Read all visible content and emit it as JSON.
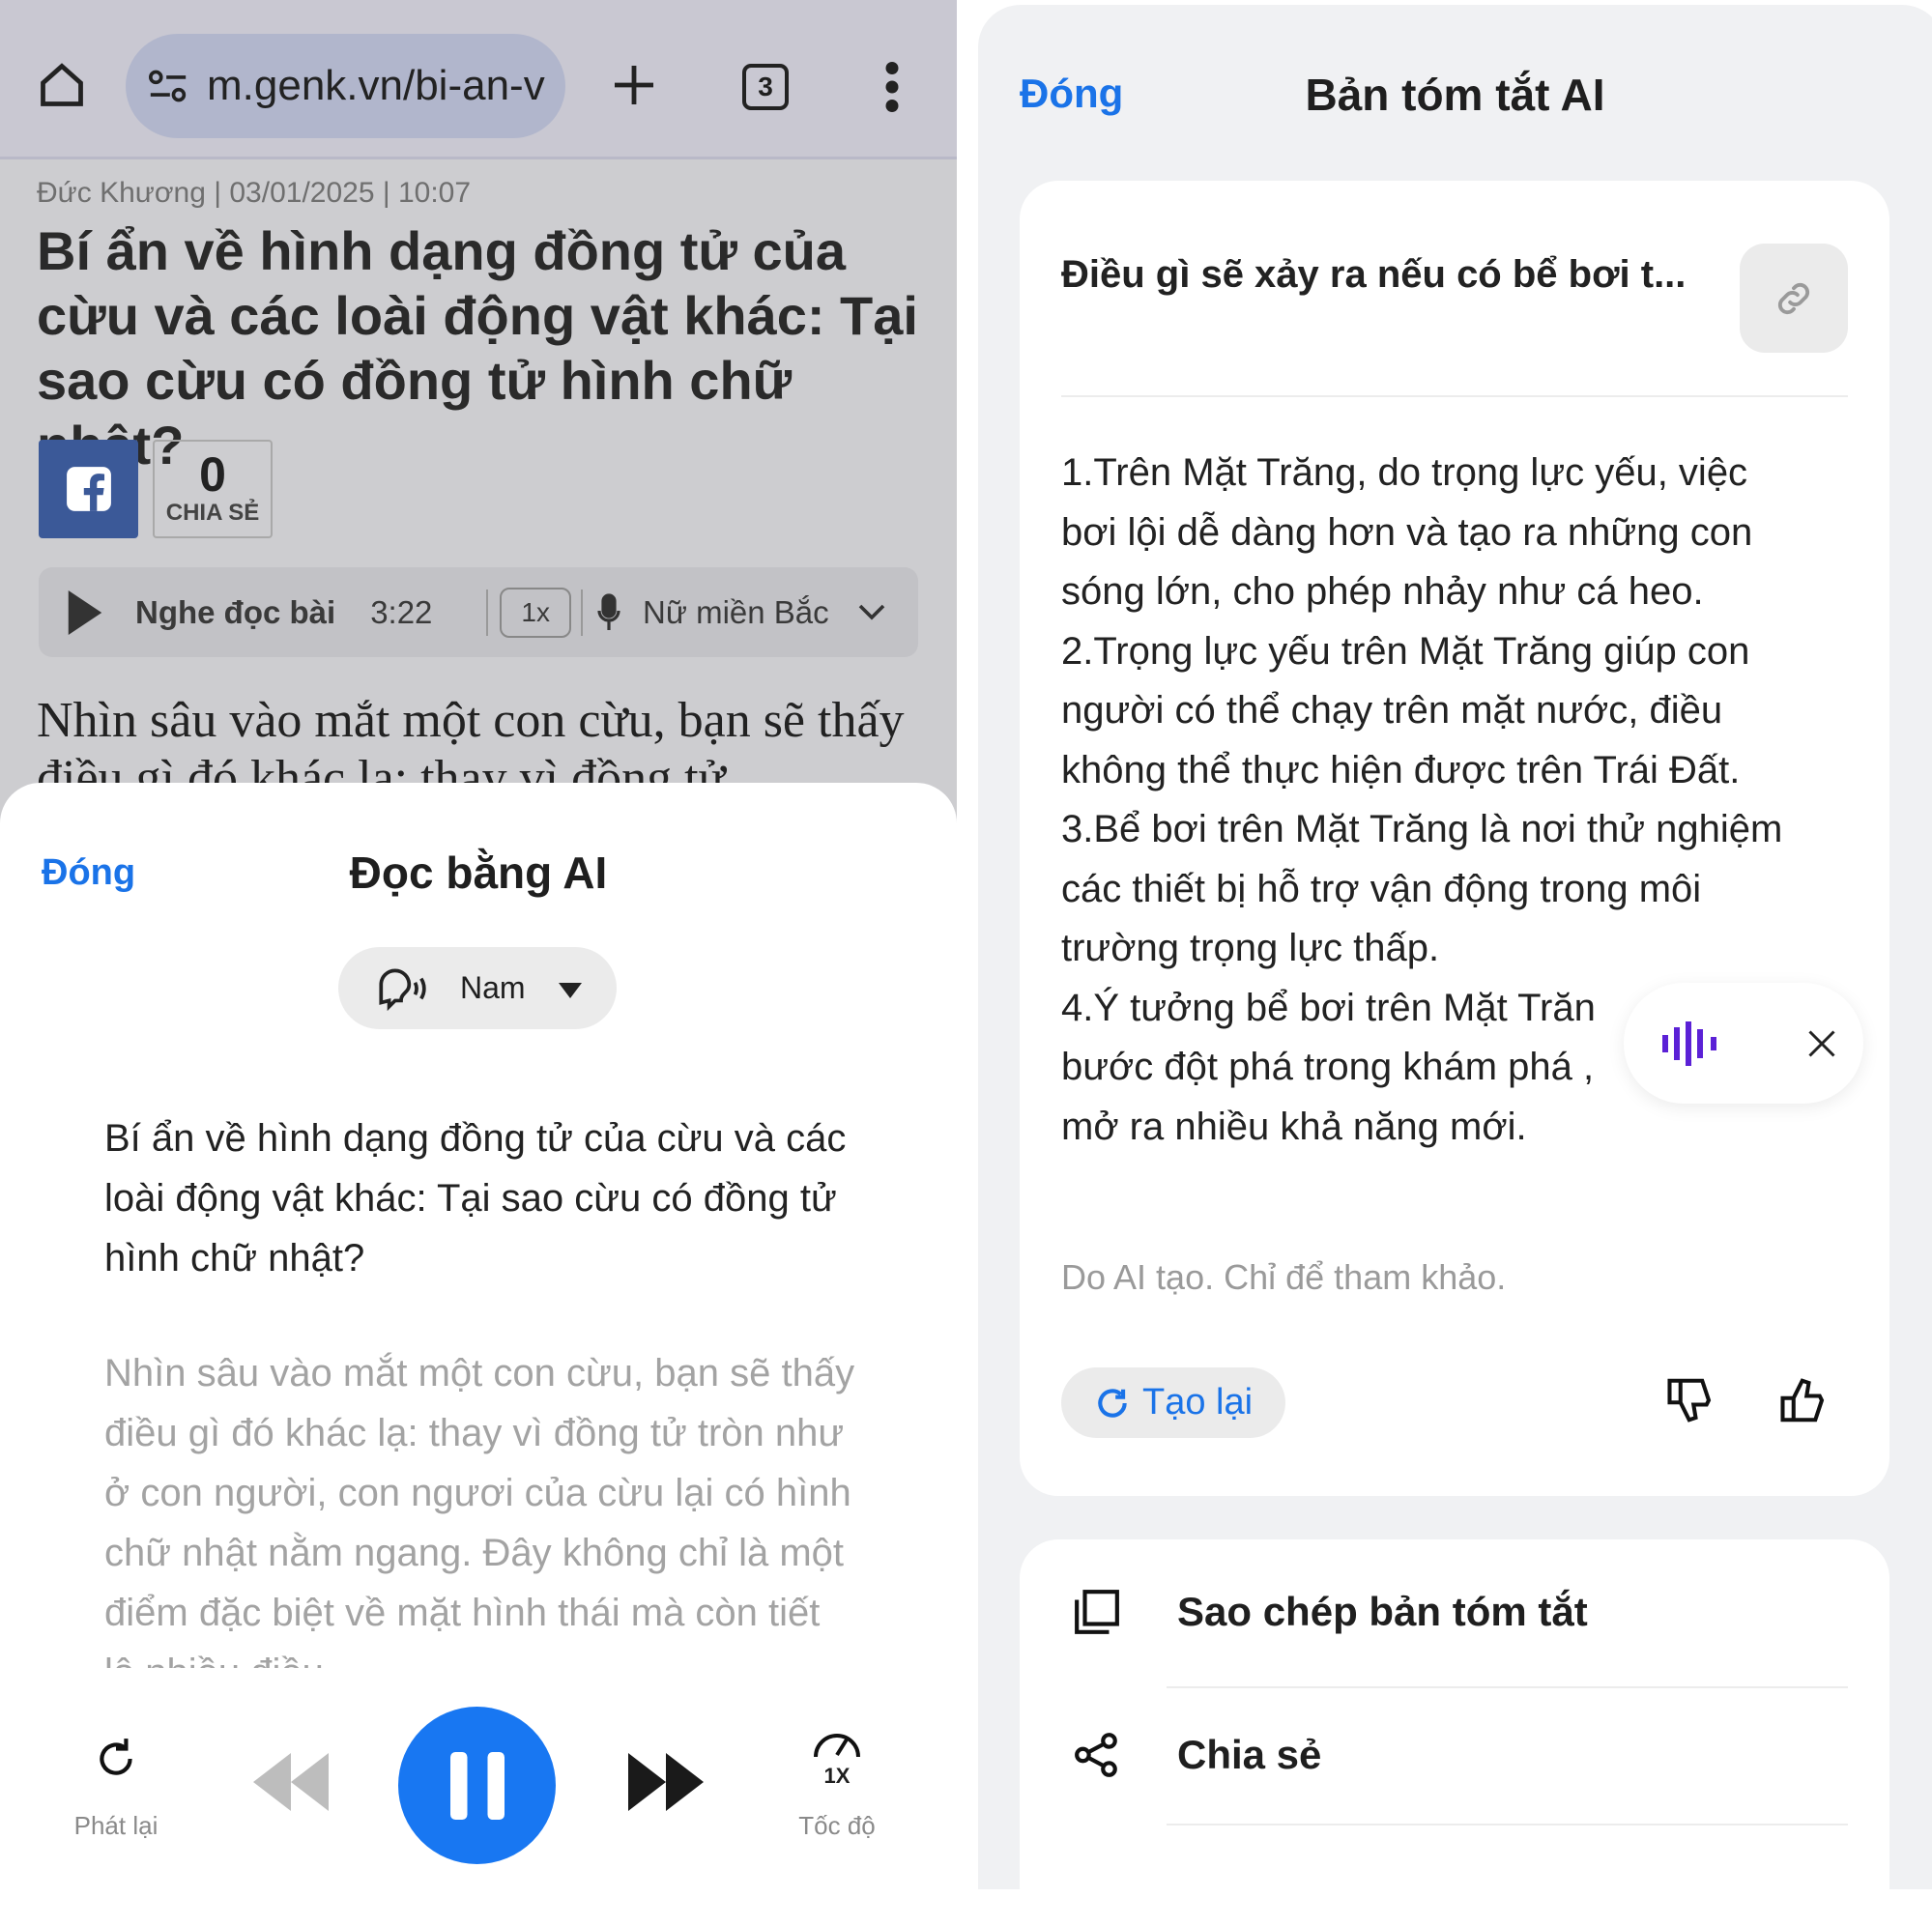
{
  "browser": {
    "url": "m.genk.vn/bi-an-v",
    "tab_count": "3"
  },
  "article": {
    "byline": "Đức Khương | 03/01/2025 | 10:07",
    "title": "Bí ẩn về hình dạng đồng tử của cừu và các loài động vật khác: Tại sao cừu có đồng tử hình chữ nhật?",
    "share_count": "0",
    "share_label": "CHIA SẺ",
    "audio": {
      "label": "Nghe đọc bài",
      "duration": "3:22",
      "speed": "1x",
      "voice": "Nữ miền Bắc"
    },
    "lead": "Nhìn sâu vào mắt một con cừu, bạn sẽ thấy điều gì đó khác lạ: thay vì đồng tử"
  },
  "read_sheet": {
    "close": "Đóng",
    "title": "Đọc bằng AI",
    "voice": "Nam",
    "heading": "Bí ẩn về hình dạng đồng tử của cừu và các loài động vật khác: Tại sao cừu có đồng tử hình chữ nhật?",
    "body": "Nhìn sâu vào mắt một con cừu, bạn sẽ thấy điều gì đó khác lạ: thay vì đồng tử tròn như ở con người, con ngươi của cừu lại có hình chữ nhật nằm ngang. Đây không chỉ là một điểm đặc biệt về mặt hình thái mà còn tiết lộ nhiều điều",
    "controls": {
      "replay": "Phát lại",
      "speed": "Tốc độ",
      "speed_value": "1X"
    },
    "accent": "#1a73e8"
  },
  "summary": {
    "close": "Đóng",
    "title": "Bản tóm tắt AI",
    "question": "Điều gì sẽ xảy ra nếu có bể bơi t...",
    "lines": [
      "1.Trên Mặt Trăng, do trọng lực yếu, việc",
      "bơi lội dễ dàng hơn và tạo ra những con",
      "sóng lớn, cho phép nhảy như cá heo.",
      "2.Trọng lực yếu trên Mặt Trăng giúp con",
      "người có thể chạy trên mặt nước, điều",
      "không thể thực hiện được trên Trái Đất.",
      "3.Bể bơi trên Mặt Trăng là nơi thử nghiệm",
      "các thiết bị hỗ trợ vận động trong môi",
      "trường trọng lực thấp.",
      "4.Ý tưởng bể bơi trên Mặt Trăn",
      "bước đột phá trong khám phá ,",
      "mở ra nhiều khả năng mới."
    ],
    "disclaimer": "Do AI tạo. Chỉ để tham khảo.",
    "regenerate": "Tạo lại",
    "actions": [
      {
        "label": "Sao chép bản tóm tắt",
        "icon": "copy-icon"
      },
      {
        "label": "Chia sẻ",
        "icon": "share-icon"
      }
    ]
  }
}
